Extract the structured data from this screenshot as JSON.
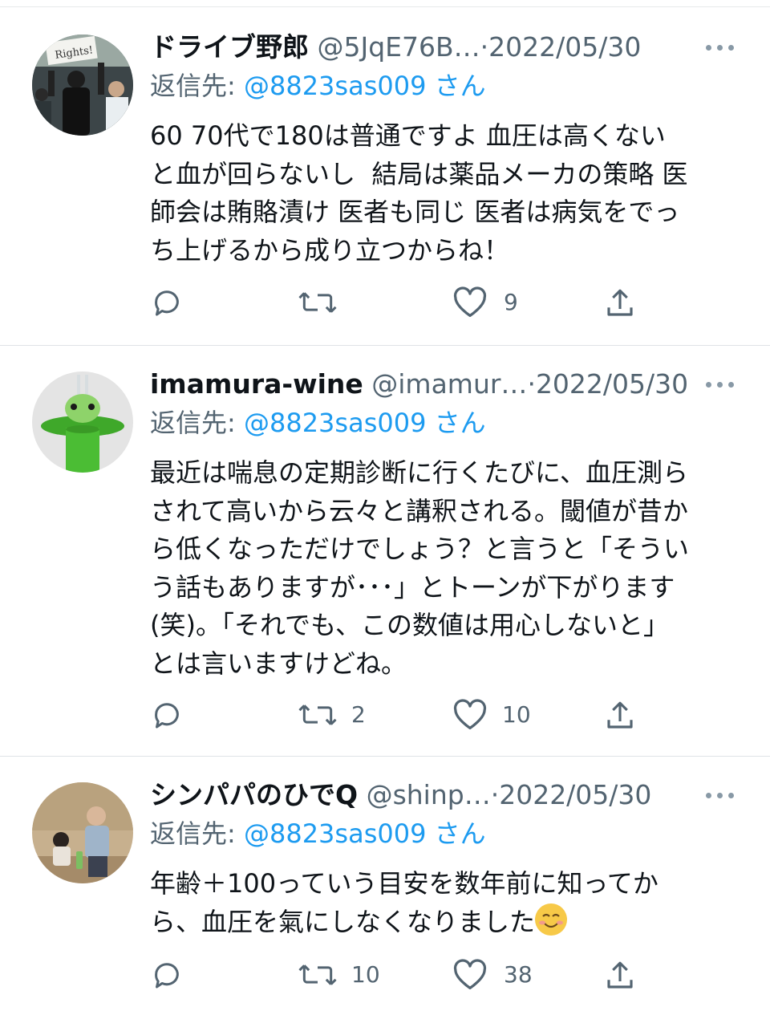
{
  "colors": {
    "accent": "#1d9bf0",
    "secondary": "#536471",
    "text": "#0f1419"
  },
  "tweets": [
    {
      "name": "ドライブ野郎",
      "handle": "@5JqE76B…",
      "sep": "·",
      "date": "2022/05/30",
      "reply_prefix": "返信先:",
      "reply_to": "@8823sas009",
      "reply_suffix": "さん",
      "text": "60 70代で180は普通ですよ 血圧は高くない\nと血が回らないし  結局は薬品メーカの策略 医\n師会は賄賂漬け 医者も同じ 医者は病気をでっ\nち上げるから成り立つからね！",
      "retweets": "",
      "likes": "9",
      "avatar_icon": "protest-photo-avatar"
    },
    {
      "name": "imamura-wine",
      "handle": "@imamur…",
      "sep": "·",
      "date": "2022/05/30",
      "reply_prefix": "返信先:",
      "reply_to": "@8823sas009",
      "reply_suffix": "さん",
      "text": "最近は喘息の定期診断に行くたびに、血圧測ら\nされて高いから云々と講釈される。閾値が昔か\nら低くなっただけでしょう？と言うと「そうい\nう話もありますが･･･」とトーンが下がります\n(笑)。「それでも、この数値は用心しないと」\nとは言いますけどね。",
      "retweets": "2",
      "likes": "10",
      "avatar_icon": "green-frog-toy-avatar"
    },
    {
      "name": "シンパパのひでQ",
      "handle": "@shinp…",
      "sep": "·",
      "date": "2022/05/30",
      "reply_prefix": "返信先:",
      "reply_to": "@8823sas009",
      "reply_suffix": "さん",
      "text": "年齢＋100っていう目安を数年前に知ってか\nら、血圧を氣にしなくなりました",
      "emoji": "smiling-face-emoji",
      "retweets": "10",
      "likes": "38",
      "avatar_icon": "family-photo-avatar"
    }
  ]
}
